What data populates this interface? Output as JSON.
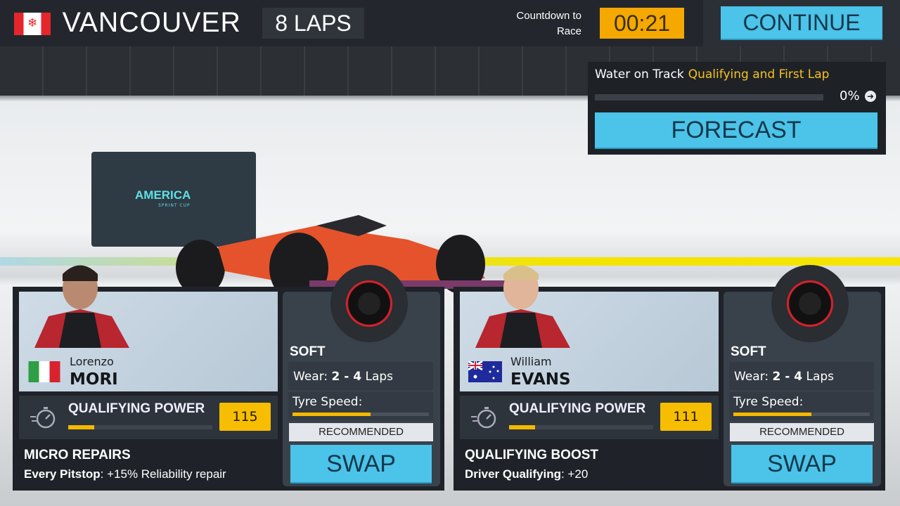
{
  "header": {
    "flag_icon": "canada-flag-icon",
    "city": "VANCOUVER",
    "laps": "8 LAPS",
    "countdown_label_1": "Countdown to",
    "countdown_label_2": "Race",
    "countdown": "00:21",
    "continue_label": "CONTINUE"
  },
  "scene": {
    "banner_title": "AMERICA",
    "banner_subtitle": "SPRINT CUP"
  },
  "weather": {
    "label": "Water on Track",
    "value": "Qualifying and First Lap",
    "percent_text": "0%",
    "percent": 0,
    "forecast_label": "FORECAST"
  },
  "colors": {
    "accent_blue": "#4cc3e9",
    "accent_yellow": "#f7bd00",
    "panel": "#1f2329"
  },
  "drivers": [
    {
      "first": "Lorenzo",
      "last": "MORI",
      "nationality_icon": "italy-flag-icon",
      "qual_label": "QUALIFYING POWER",
      "qual_value": "115",
      "qual_fill_pct": 18,
      "trait_name": "MICRO REPAIRS",
      "trait_key": "Every Pitstop",
      "trait_value": ": +15% Reliability repair",
      "tyre": "SOFT",
      "wear_label": "Wear:",
      "wear_value": "2 - 4",
      "wear_unit": "Laps",
      "speed_label": "Tyre Speed:",
      "speed_fill_pct": 57,
      "recommended": "RECOMMENDED",
      "swap": "SWAP"
    },
    {
      "first": "William",
      "last": "EVANS",
      "nationality_icon": "australia-flag-icon",
      "qual_label": "QUALIFYING POWER",
      "qual_value": "111",
      "qual_fill_pct": 18,
      "trait_name": "QUALIFYING BOOST",
      "trait_key": "Driver Qualifying",
      "trait_value": ": +20",
      "tyre": "SOFT",
      "wear_label": "Wear:",
      "wear_value": "2 - 4",
      "wear_unit": "Laps",
      "speed_label": "Tyre Speed:",
      "speed_fill_pct": 57,
      "recommended": "RECOMMENDED",
      "swap": "SWAP"
    }
  ]
}
